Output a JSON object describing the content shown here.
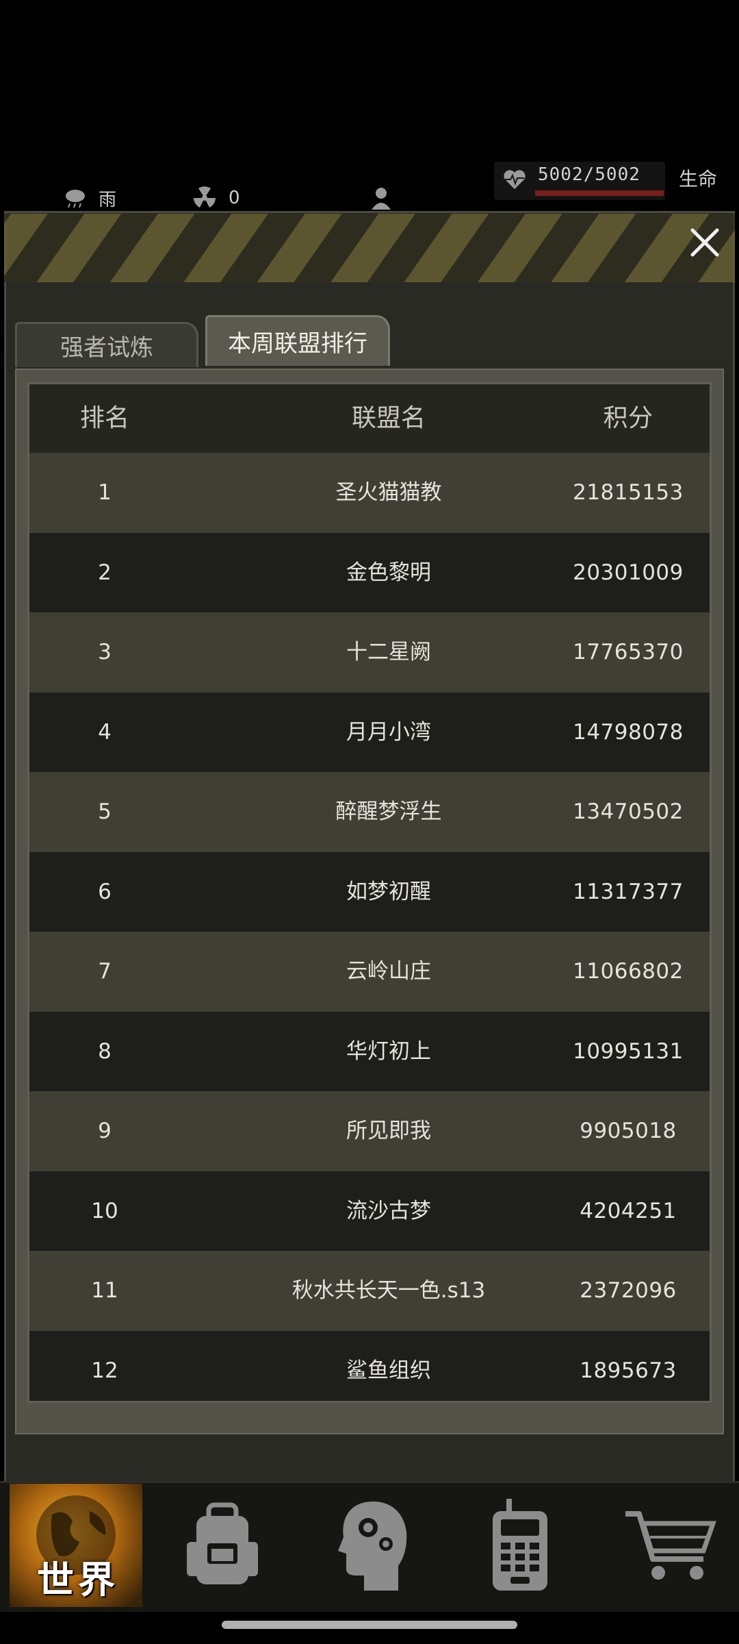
{
  "status": {
    "weather_label": "雨",
    "radiation_value": "0",
    "health": "5002/5002",
    "health_label": "生命"
  },
  "tabs": [
    {
      "label": "强者试炼",
      "active": false
    },
    {
      "label": "本周联盟排行",
      "active": true
    }
  ],
  "table": {
    "headers": {
      "rank": "排名",
      "name": "联盟名",
      "score": "积分"
    },
    "rows": [
      {
        "rank": "1",
        "name": "圣火猫猫教",
        "score": "21815153"
      },
      {
        "rank": "2",
        "name": "金色黎明",
        "score": "20301009"
      },
      {
        "rank": "3",
        "name": "十二星阙",
        "score": "17765370"
      },
      {
        "rank": "4",
        "name": "月月小湾",
        "score": "14798078"
      },
      {
        "rank": "5",
        "name": "醉醒梦浮生",
        "score": "13470502"
      },
      {
        "rank": "6",
        "name": "如梦初醒",
        "score": "11317377"
      },
      {
        "rank": "7",
        "name": "云岭山庄",
        "score": "11066802"
      },
      {
        "rank": "8",
        "name": "华灯初上",
        "score": "10995131"
      },
      {
        "rank": "9",
        "name": "所见即我",
        "score": "9905018"
      },
      {
        "rank": "10",
        "name": "流沙古梦",
        "score": "4204251"
      },
      {
        "rank": "11",
        "name": "秋水共长天一色.s13",
        "score": "2372096"
      },
      {
        "rank": "12",
        "name": "鲨鱼组织",
        "score": "1895673"
      }
    ]
  },
  "nav": {
    "world_label": "世界",
    "items": [
      "globe-icon",
      "backpack-icon",
      "skills-head-icon",
      "radio-device-icon",
      "shopping-cart-icon"
    ]
  },
  "colors": {
    "accent": "#f0b030",
    "health_bar": "#7a1e1e"
  }
}
